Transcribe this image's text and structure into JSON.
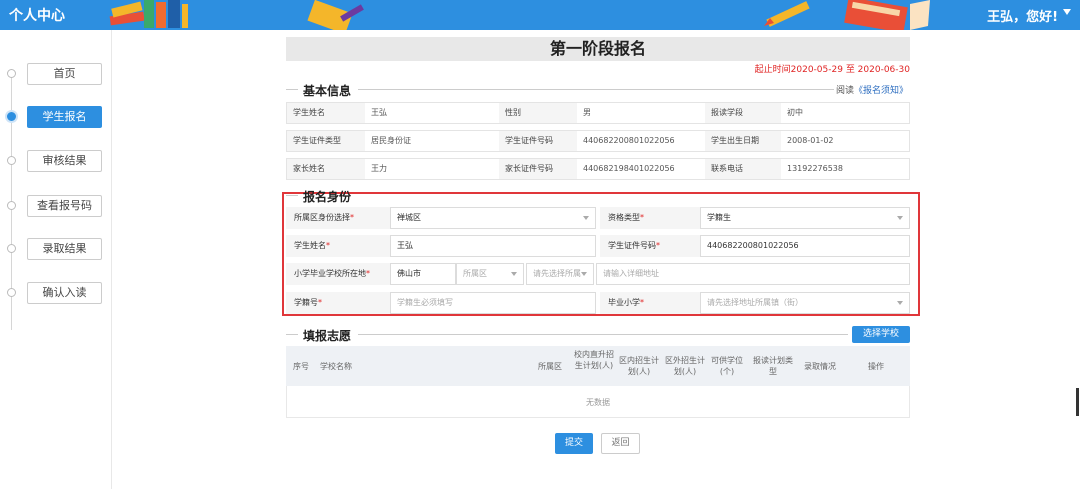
{
  "header": {
    "app_title": "个人中心",
    "greeting": "王弘，您好!",
    "accent": "#2d8fe0"
  },
  "sidebar": {
    "items": [
      {
        "label": "首页",
        "active": false
      },
      {
        "label": "学生报名",
        "active": true
      },
      {
        "label": "审核结果",
        "active": false
      },
      {
        "label": "查看报号码",
        "active": false
      },
      {
        "label": "录取结果",
        "active": false
      },
      {
        "label": "确认入读",
        "active": false
      }
    ]
  },
  "main": {
    "title": "第一阶段报名",
    "deadline": "起止时间2020-05-29 至 2020-06-30",
    "basic_info": {
      "section_title": "基本信息",
      "notice_prefix": "阅读",
      "notice_link": "《报名须知》",
      "rows": [
        [
          {
            "label": "学生姓名",
            "value": "王弘"
          },
          {
            "label": "性别",
            "value": "男"
          },
          {
            "label": "报读学段",
            "value": "初中"
          }
        ],
        [
          {
            "label": "学生证件类型",
            "value": "居民身份证"
          },
          {
            "label": "学生证件号码",
            "value": "440682200801022056"
          },
          {
            "label": "学生出生日期",
            "value": "2008-01-02"
          }
        ],
        [
          {
            "label": "家长姓名",
            "value": "王力"
          },
          {
            "label": "家长证件号码",
            "value": "440682198401022056"
          },
          {
            "label": "联系电话",
            "value": "13192276538"
          }
        ]
      ]
    },
    "identity": {
      "section_title": "报名身份",
      "district_label": "所属区身份选择",
      "district_value": "禅城区",
      "eligibility_label": "资格类型",
      "eligibility_value": "学籍生",
      "student_name_label": "学生姓名",
      "student_name_value": "王弘",
      "student_id_label": "学生证件号码",
      "student_id_value": "440682200801022056",
      "school_location_label": "小学毕业学校所在地",
      "city_value": "佛山市",
      "district_placeholder": "所属区",
      "street_placeholder": "请先选择所属",
      "address_placeholder": "请输入详细地址",
      "student_no_label": "学籍号",
      "student_no_placeholder": "学籍生必须填写",
      "graduate_school_label": "毕业小学",
      "graduate_school_placeholder": "请先选择地址所属镇（街）"
    },
    "wishes": {
      "section_title": "填报志愿",
      "select_school_button": "选择学校",
      "columns": [
        "序号",
        "学校名称",
        "所属区",
        "校内直升招生计划(人)",
        "区内招生计划(人)",
        "区外招生计划(人)",
        "可供学位(个)",
        "报读计划类型",
        "录取情况",
        "操作"
      ],
      "empty_text": "无数据"
    },
    "buttons": {
      "submit": "提交",
      "back": "返回"
    }
  }
}
